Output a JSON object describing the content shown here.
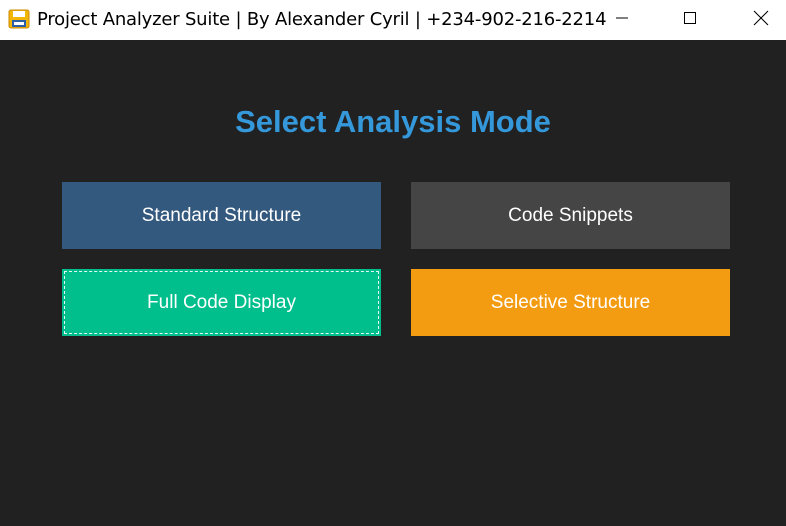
{
  "window": {
    "title": "Project Analyzer Suite | By Alexander Cyril | +234-902-216-2214",
    "app_icon": "floppy-disk-icon"
  },
  "window_controls": {
    "minimize_icon": "minimize-icon",
    "maximize_icon": "maximize-icon",
    "close_icon": "close-icon"
  },
  "main": {
    "heading": "Select Analysis Mode",
    "heading_color": "#3498db",
    "background_color": "#212121",
    "buttons": [
      {
        "label": "Standard Structure",
        "color": "#34597e"
      },
      {
        "label": "Code Snippets",
        "color": "#454545"
      },
      {
        "label": "Full Code Display",
        "color": "#00bf8c",
        "focused": true
      },
      {
        "label": "Selective Structure",
        "color": "#f39c12"
      }
    ]
  }
}
